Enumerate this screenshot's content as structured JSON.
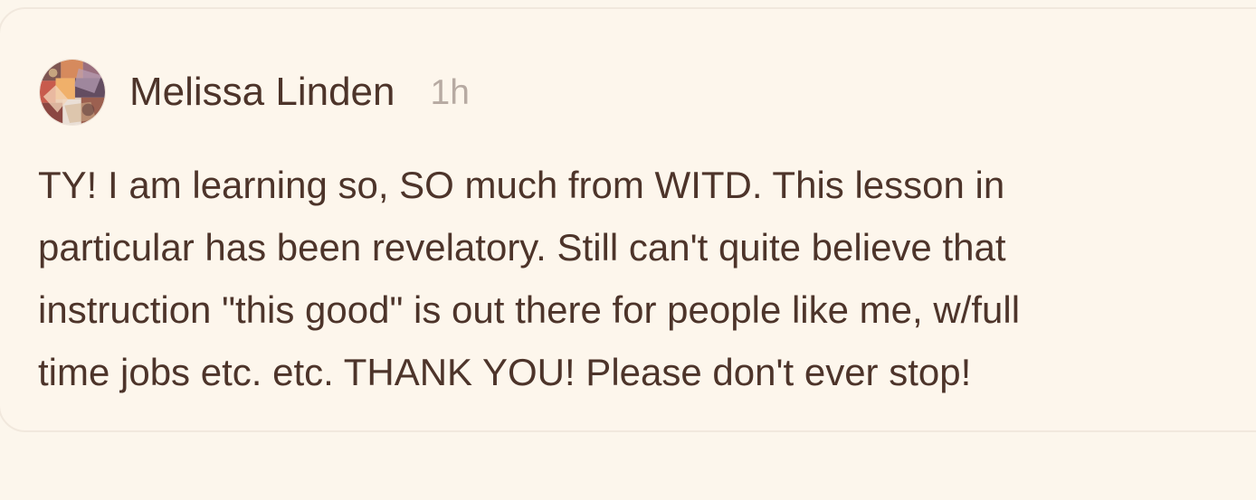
{
  "comment": {
    "author": "Melissa Linden",
    "time_ago": "1h",
    "avatar_icon": "avatar-image",
    "text_lines": [
      "TY! I am learning so, SO much from WITD. This lesson in",
      "particular has been revelatory. Still can't quite believe that",
      "instruction \"this good\" is out there for people like me, w/full",
      "time jobs etc. etc. THANK YOU! Please don't ever stop!"
    ]
  },
  "colors": {
    "background": "#fcf6ec",
    "card_background": "#fdf6ec",
    "text": "#4d342a",
    "muted_text": "#b7aaa2",
    "card_border": "#f1e8dd"
  }
}
